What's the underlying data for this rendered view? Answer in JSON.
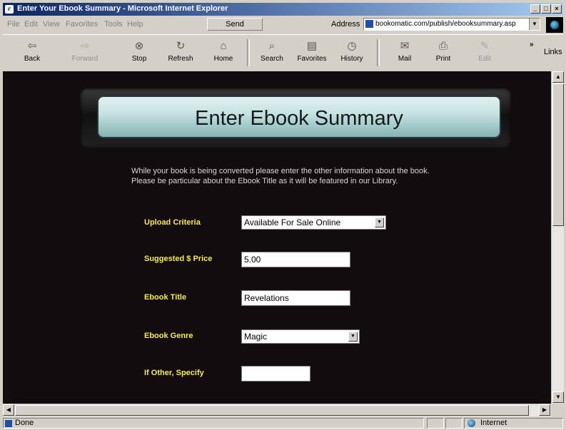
{
  "window": {
    "title": "Enter Your Ebook Summary - Microsoft Internet Explorer"
  },
  "menu": [
    "File",
    "Edit",
    "View",
    "Favorites",
    "Tools",
    "Help"
  ],
  "send_label": "Send",
  "address": {
    "label": "Address",
    "url": "bookomatic.com/publish/ebooksummary.asp"
  },
  "toolbar": {
    "back": "Back",
    "forward": "Forward",
    "stop": "Stop",
    "refresh": "Refresh",
    "home": "Home",
    "search": "Search",
    "favorites": "Favorites",
    "history": "History",
    "mail": "Mail",
    "print": "Print",
    "edit": "Edit",
    "links": "Links"
  },
  "page": {
    "banner_title": "Enter Ebook Summary",
    "intro_line1": "While your book is being converted please enter the other information about the book.",
    "intro_line2": "Please be particular about the Ebook Title as it will be featured in our Library."
  },
  "form": {
    "upload_criteria": {
      "label": "Upload Criteria",
      "value": "Available For Sale Online"
    },
    "price": {
      "label": "Suggested $ Price",
      "value": "5.00"
    },
    "title": {
      "label": "Ebook Title",
      "value": "Revelations"
    },
    "genre": {
      "label": "Ebook Genre",
      "value": "Magic"
    },
    "other": {
      "label": "If Other, Specify",
      "value": ""
    }
  },
  "status": {
    "text": "Done",
    "zone": "Internet"
  }
}
